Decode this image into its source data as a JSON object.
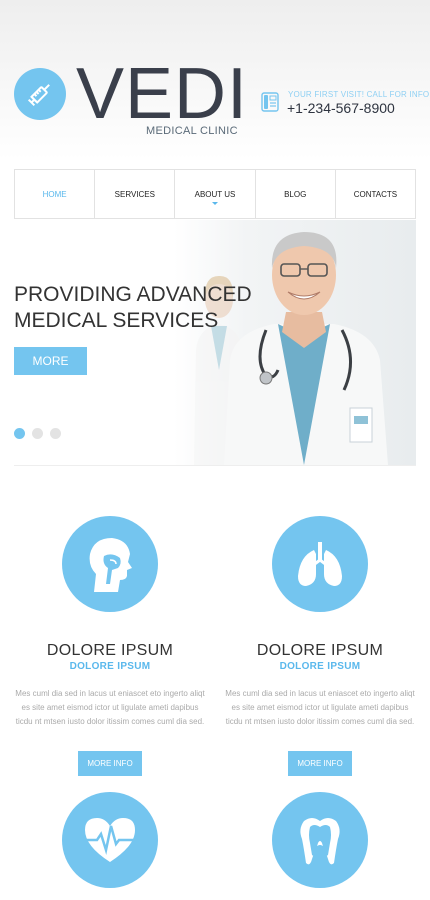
{
  "colors": {
    "accent": "#74c5ef",
    "accent_text": "#5ab8ec",
    "logo_text": "#3a3f4b"
  },
  "header": {
    "logo_icon": "syringe-icon",
    "logo_text": "VEDI",
    "logo_subtitle": "MEDICAL CLINIC",
    "call_label": "YOUR FIRST VISIT! CALL FOR INFO",
    "phone_icon": "phone-icon",
    "phone": "+1-234-567-8900"
  },
  "nav": {
    "items": [
      {
        "label": "HOME"
      },
      {
        "label": "SERVICES"
      },
      {
        "label": "ABOUT US"
      },
      {
        "label": "BLOG"
      },
      {
        "label": "CONTACTS"
      }
    ]
  },
  "slider": {
    "headline_line1": "PROVIDING ADVANCED",
    "headline_line2": "MEDICAL SERVICES",
    "button_label": "MORE"
  },
  "features": [
    {
      "icon": "head-profile-icon",
      "title": "DOLORE IPSUM",
      "subtitle": "DOLORE IPSUM",
      "body": "Mes cuml dia sed in lacus ut eniascet eto ingerto aliqt es site amet eismod ictor ut ligulate ameti dapibus ticdu nt mtsen iusto dolor itissim comes cuml dia sed.",
      "button_label": "MORE INFO"
    },
    {
      "icon": "lungs-icon",
      "title": "DOLORE IPSUM",
      "subtitle": "DOLORE IPSUM",
      "body": "Mes cuml dia sed in lacus ut eniascet eto ingerto aliqt es site amet eismod ictor ut ligulate ameti dapibus ticdu nt mtsen iusto dolor itissim comes cuml dia sed.",
      "button_label": "MORE INFO"
    },
    {
      "icon": "heart-pulse-icon"
    },
    {
      "icon": "tooth-icon"
    }
  ]
}
